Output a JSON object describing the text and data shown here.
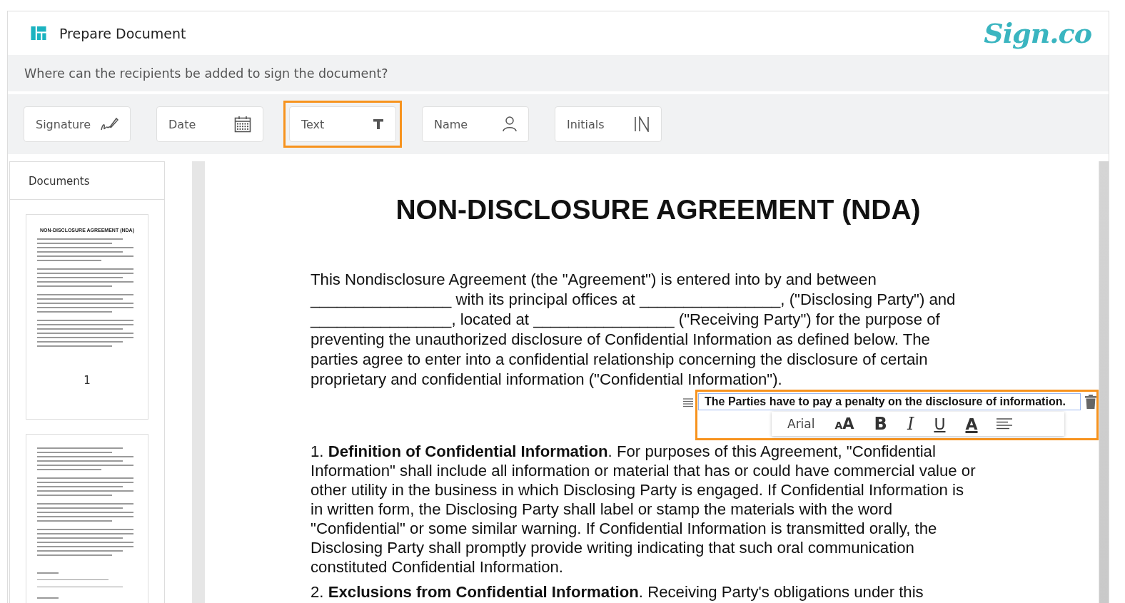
{
  "header": {
    "title": "Prepare Document",
    "logo": "Sign.co"
  },
  "question": "Where can the recipients be added to sign the document?",
  "tools": [
    {
      "label": "Signature",
      "kind": "signature",
      "selected": false
    },
    {
      "label": "Date",
      "kind": "date",
      "selected": false
    },
    {
      "label": "Text",
      "kind": "text",
      "selected": true
    },
    {
      "label": "Name",
      "kind": "name",
      "selected": false
    },
    {
      "label": "Initials",
      "kind": "initials",
      "selected": false
    }
  ],
  "sidebar": {
    "title": "Documents",
    "pages": [
      {
        "kind": "title_page",
        "heading": "NON-DISCLOSURE AGREEMENT (NDA)",
        "number": "1"
      },
      {
        "kind": "signature_page"
      }
    ]
  },
  "document": {
    "title": "NON-DISCLOSURE AGREEMENT (NDA)",
    "paragraphs": [
      "This Nondisclosure Agreement (the \"Agreement\") is entered into by and between ________________ with its principal offices at ________________, (\"Disclosing Party\") and ________________, located at ________________ (\"Receiving Party\") for the purpose of preventing the unauthorized disclosure of Confidential Information as defined below. The parties agree to enter into a confidential relationship concerning the disclosure of certain proprietary and confidential information (\"Confidential Information\").",
      "1. **Definition of Confidential Information**. For purposes of this Agreement, \"Confidential Information\" shall include all information or material that has or could have commercial value or other utility in the business in which Disclosing Party is engaged. If Confidential Information is in written form, the Disclosing Party shall label or stamp the materials with the word \"Confidential\" or some similar warning. If Confidential Information is transmitted orally, the Disclosing Party shall promptly provide writing indicating that such oral communication constituted Confidential Information.",
      "2. **Exclusions from Confidential Information**. Receiving Party's obligations under this"
    ]
  },
  "text_field": {
    "value": "The Parties have to pay a penalty on the disclosure of information.",
    "format": [
      {
        "kind": "font",
        "label": "Arial"
      },
      {
        "kind": "size",
        "label": "AA"
      },
      {
        "kind": "bold",
        "label": "B"
      },
      {
        "kind": "italic",
        "label": "I"
      },
      {
        "kind": "underline",
        "label": "U"
      },
      {
        "kind": "color",
        "label": "A"
      },
      {
        "kind": "align"
      }
    ]
  }
}
